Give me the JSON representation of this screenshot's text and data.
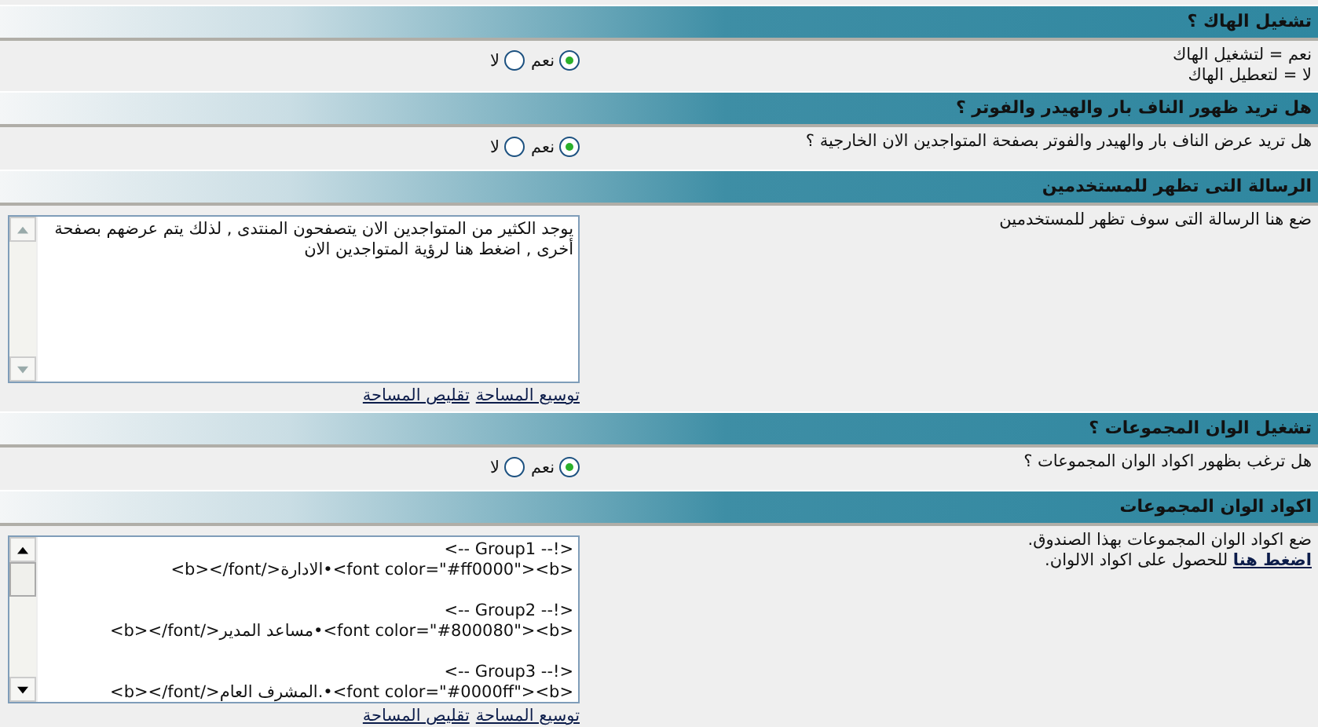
{
  "sections": [
    {
      "title": "تشغيل الهاك ؟",
      "kind": "radio",
      "description": [
        {
          "text": "نعم = لتشغيل الهاك"
        },
        {
          "text": "لا = لتعطيل الهاك"
        }
      ],
      "options": [
        {
          "label": "نعم",
          "selected": true
        },
        {
          "label": "لا",
          "selected": false
        }
      ]
    },
    {
      "title": "هل تريد ظهور الناف بار والهيدر والفوتر ؟",
      "kind": "radio",
      "description": [
        {
          "text": "هل تريد عرض الناف بار والهيدر والفوتر بصفحة المتواجدين الان الخارجية ؟"
        }
      ],
      "options": [
        {
          "label": "نعم",
          "selected": true
        },
        {
          "label": "لا",
          "selected": false
        }
      ]
    },
    {
      "title": "الرسالة التى تظهر للمستخدمين",
      "kind": "textarea",
      "description": [
        {
          "text": "ضع هنا الرسالة التى سوف تظهر للمستخدمين"
        }
      ],
      "value": "يوجد الكثير من المتواجدين الان يتصفحون المنتدى , لذلك يتم عرضهم بصفحة أخرى , اضغط هنا لرؤية المتواجدين الان",
      "scrollable": false,
      "links": [
        "توسيع المساحة",
        "تقليص المساحة"
      ]
    },
    {
      "title": "تشغيل الوان المجموعات ؟",
      "kind": "radio",
      "description": [
        {
          "text": "هل ترغب بظهور اكواد الوان المجموعات ؟"
        }
      ],
      "options": [
        {
          "label": "نعم",
          "selected": true
        },
        {
          "label": "لا",
          "selected": false
        }
      ]
    },
    {
      "title": "اكواد الوان المجموعات",
      "kind": "textarea",
      "description": [
        {
          "text": "ضع اكواد الوان المجموعات بهذا الصندوق."
        },
        {
          "link": "اضغط هنا",
          "text": " للحصول على اكواد الالوان."
        }
      ],
      "value": "<-- Group1 --!>\n<b></font/>الادارة•<font color=\"#ff0000\"><b>\n\n<-- Group2 --!>\n<b></font/>مساعد المدير•<font color=\"#800080\"><b>\n\n<-- Group3 --!>\n<b></font/>المشرف العام.•<font color=\"#0000ff\"><b>",
      "scrollable": true,
      "links": [
        "توسيع المساحة",
        "تقليص المساحة"
      ]
    }
  ]
}
